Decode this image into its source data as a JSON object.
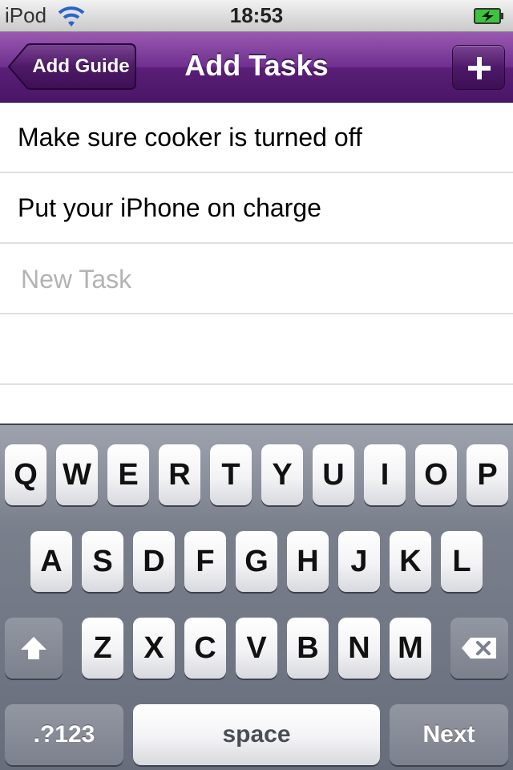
{
  "status_bar": {
    "carrier": "iPod",
    "time": "18:53",
    "wifi_icon": "wifi-icon",
    "battery_icon": "battery-charging-icon"
  },
  "nav": {
    "back_label": "Add Guide",
    "title": "Add Tasks",
    "add_icon": "plus-icon"
  },
  "tasks": [
    {
      "text": "Make sure cooker is turned off"
    },
    {
      "text": "Put your iPhone on charge"
    }
  ],
  "new_task": {
    "value": "",
    "placeholder": "New Task"
  },
  "keyboard": {
    "row1": [
      "Q",
      "W",
      "E",
      "R",
      "T",
      "Y",
      "U",
      "I",
      "O",
      "P"
    ],
    "row2": [
      "A",
      "S",
      "D",
      "F",
      "G",
      "H",
      "J",
      "K",
      "L"
    ],
    "row3": [
      "Z",
      "X",
      "C",
      "V",
      "B",
      "N",
      "M"
    ],
    "shift_icon": "shift-icon",
    "delete_icon": "delete-backspace-icon",
    "numbers_label": ".?123",
    "space_label": "space",
    "return_label": "Next"
  },
  "colors": {
    "nav_purple": "#6e2f8f",
    "keyboard_gray": "#7a7f8c"
  }
}
